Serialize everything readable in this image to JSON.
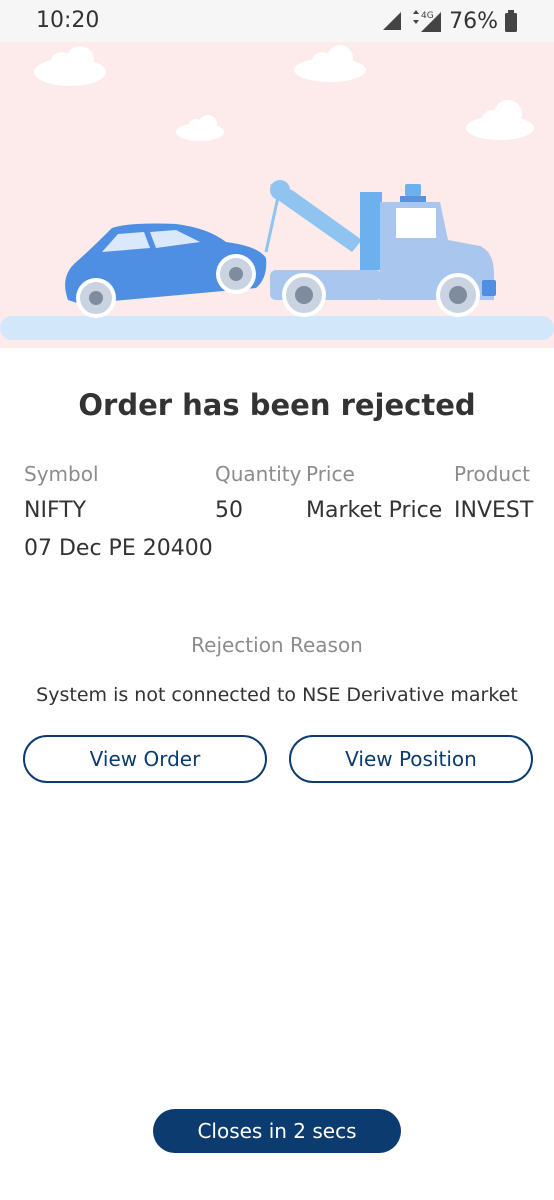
{
  "status_bar": {
    "time": "10:20",
    "network": "4G",
    "battery": "76%"
  },
  "dialog": {
    "title": "Order has been rejected",
    "columns": [
      {
        "label": "Symbol",
        "value": "NIFTY",
        "value2": "07 Dec PE 20400"
      },
      {
        "label": "Quantity",
        "value": "50"
      },
      {
        "label": "Price",
        "value": "Market Price"
      },
      {
        "label": "Product",
        "value": "INVEST"
      }
    ],
    "rejection_label": "Rejection Reason",
    "rejection_text": "System is not connected to NSE Derivative market",
    "view_order_label": "View Order",
    "view_position_label": "View Position",
    "closes_label": "Closes in 2 secs"
  },
  "colors": {
    "brand": "#0c3b6f",
    "hero_background": "#fdeaea"
  },
  "illustration": "tow-truck-towing-car"
}
